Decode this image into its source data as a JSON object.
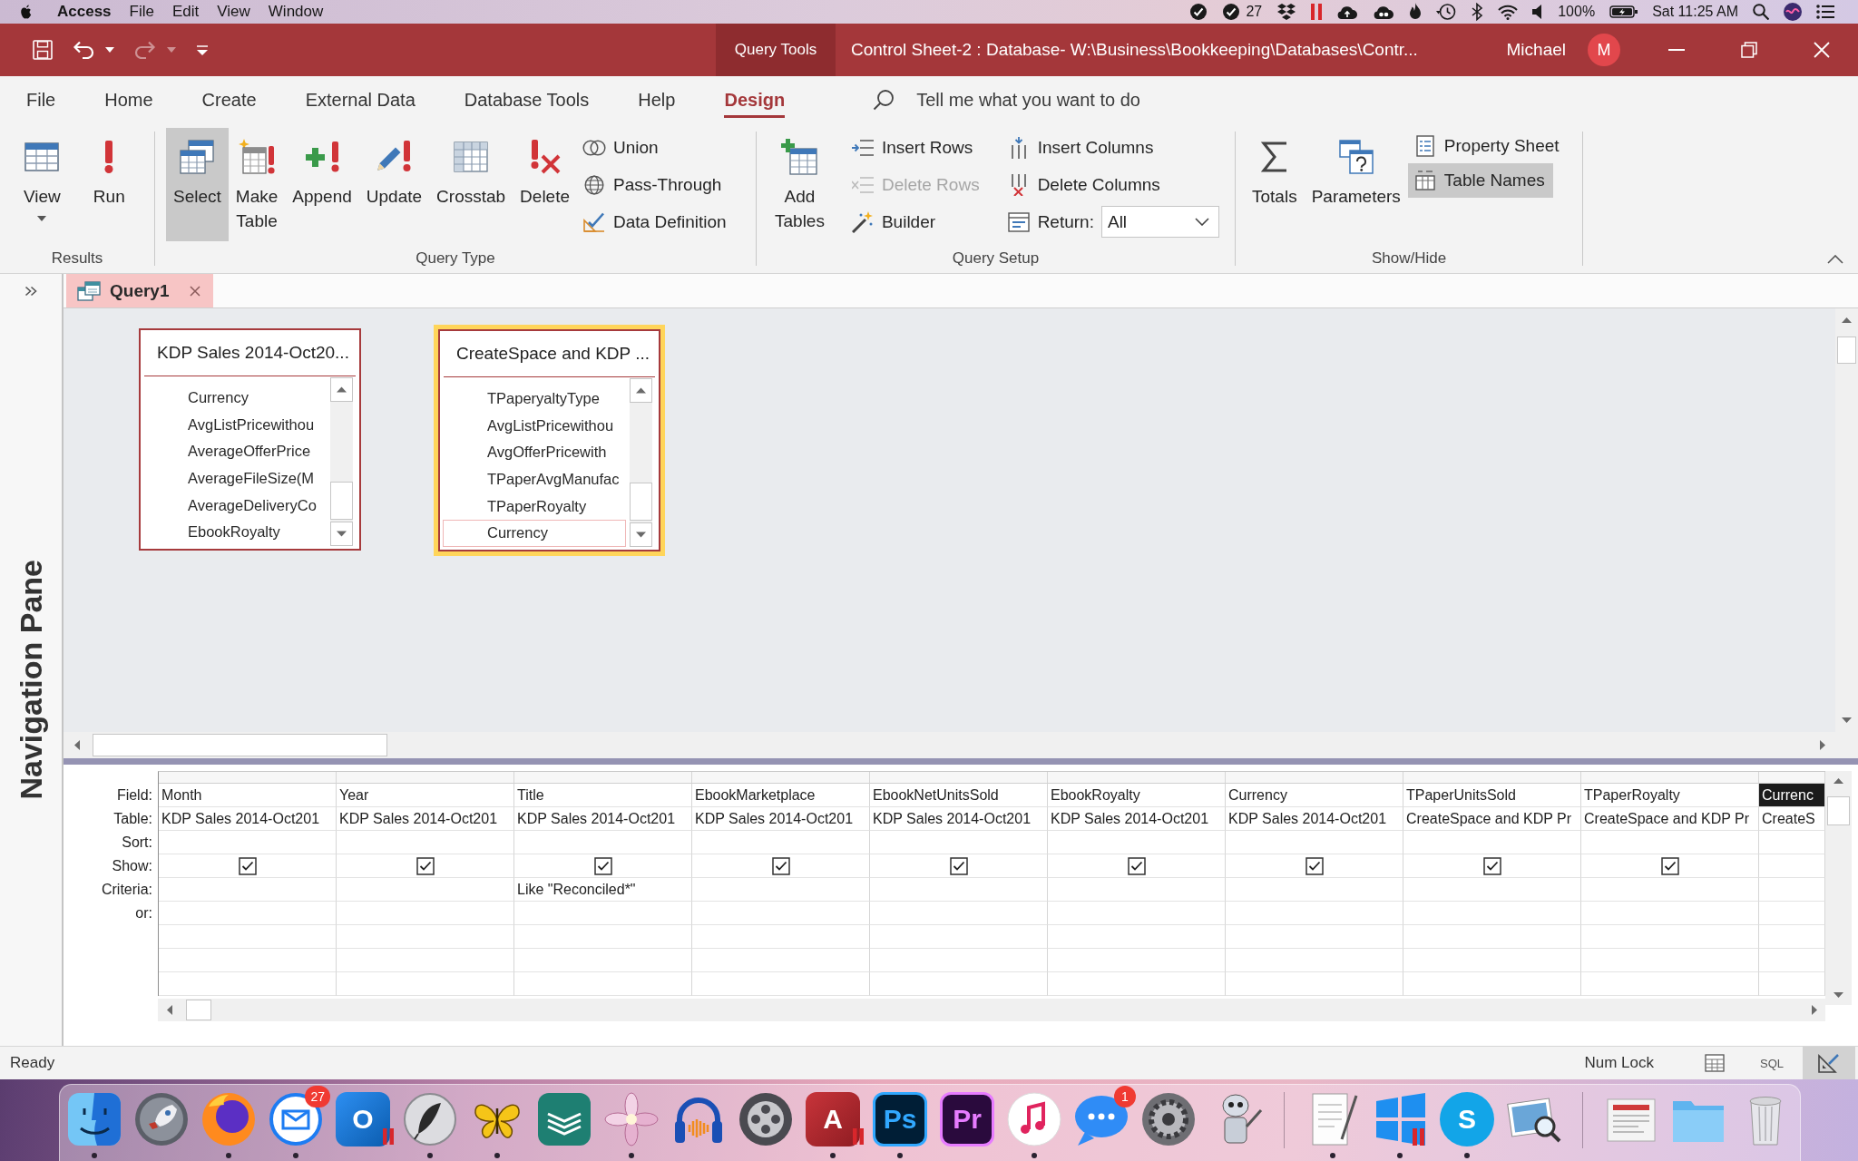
{
  "menu_bar": {
    "app": "Access",
    "menus": [
      "File",
      "Edit",
      "View",
      "Window"
    ],
    "mail_count": "27",
    "battery": "100%",
    "clock": "Sat 11:25 AM"
  },
  "title_bar": {
    "quick_access": [
      {
        "disabled": false
      },
      {
        "disabled": false
      },
      {
        "disabled": true
      },
      {
        "disabled": false
      }
    ],
    "context_tab": "Query Tools",
    "title": "Control Sheet-2 : Database- W:\\Business\\Bookkeeping\\Databases\\Contr...",
    "user": "Michael",
    "avatar": "M"
  },
  "ribbon": {
    "tabs": [
      {
        "label": "File",
        "selected": false
      },
      {
        "label": "Home",
        "selected": false
      },
      {
        "label": "Create",
        "selected": false
      },
      {
        "label": "External Data",
        "selected": false
      },
      {
        "label": "Database Tools",
        "selected": false
      },
      {
        "label": "Help",
        "selected": false
      },
      {
        "label": "Design",
        "selected": true
      }
    ],
    "search": {
      "placeholder": "Tell me what you want to do"
    },
    "groups": [
      {
        "label": "Results",
        "items": [
          {
            "kind": "large",
            "label": "View",
            "dropdown": true
          },
          {
            "kind": "large",
            "label": "Run"
          }
        ]
      },
      {
        "label": "Query Type",
        "items": [
          {
            "kind": "large",
            "label": "Select",
            "selected": true
          },
          {
            "kind": "large",
            "label": "Make Table",
            "selected": false
          },
          {
            "kind": "large",
            "label": "Append",
            "selected": false
          },
          {
            "kind": "large",
            "label": "Update",
            "selected": false
          },
          {
            "kind": "large",
            "label": "Crosstab",
            "selected": false
          },
          {
            "kind": "large",
            "label": "Delete",
            "selected": false
          },
          {
            "kind": "stack",
            "items": [
              {
                "kind": "small",
                "label": "Union",
                "selected": false
              },
              {
                "kind": "small",
                "label": "Pass-Through",
                "selected": false
              },
              {
                "kind": "small",
                "label": "Data Definition",
                "selected": false
              }
            ]
          }
        ]
      },
      {
        "label": "Query Setup",
        "items": [
          {
            "kind": "large",
            "label": "Add Tables"
          },
          {
            "kind": "stack",
            "items": [
              {
                "kind": "small",
                "label": "Insert Rows",
                "disabled": false
              },
              {
                "kind": "small",
                "label": "Delete Rows",
                "disabled": true
              },
              {
                "kind": "small",
                "label": "Builder",
                "disabled": false
              }
            ]
          },
          {
            "kind": "stack",
            "items": [
              {
                "kind": "small",
                "label": "Insert Columns",
                "disabled": false
              },
              {
                "kind": "small",
                "label": "Delete Columns",
                "disabled": false
              },
              {
                "kind": "select",
                "label": "Return:",
                "value": "All"
              }
            ]
          }
        ]
      },
      {
        "label": "Show/Hide",
        "items": [
          {
            "kind": "large",
            "label": "Totals",
            "selected": false
          },
          {
            "kind": "large",
            "label": "Parameters"
          },
          {
            "kind": "stack",
            "items": [
              {
                "kind": "small",
                "label": "Property Sheet",
                "selected": false
              },
              {
                "kind": "small",
                "label": "Table Names",
                "selected": true
              }
            ]
          }
        ]
      }
    ]
  },
  "navigation_pane": {
    "label": "Navigation Pane"
  },
  "document_tabs": [
    {
      "label": "Query1",
      "selected": true
    }
  ],
  "query_design": {
    "tables": [
      {
        "title": "KDP Sales 2014-Oct20...",
        "selected": false,
        "fields": [
          {
            "name": "Currency",
            "selected": false
          },
          {
            "name": "AvgListPricewithou",
            "selected": false
          },
          {
            "name": "AverageOfferPrice",
            "selected": false
          },
          {
            "name": "AverageFileSize(M",
            "selected": false
          },
          {
            "name": "AverageDeliveryCo",
            "selected": false
          },
          {
            "name": "EbookRoyalty",
            "selected": false
          }
        ]
      },
      {
        "title": "CreateSpace and KDP ...",
        "selected": true,
        "fields": [
          {
            "name": "TPaperyaltyType",
            "selected": false
          },
          {
            "name": "AvgListPricewithou",
            "selected": false
          },
          {
            "name": "AvgOfferPricewith",
            "selected": false
          },
          {
            "name": "TPaperAvgManufac",
            "selected": false
          },
          {
            "name": "TPaperRoyalty",
            "selected": false
          },
          {
            "name": "Currency",
            "selected": true
          }
        ]
      }
    ]
  },
  "design_grid": {
    "row_labels": [
      "Field:",
      "Table:",
      "Sort:",
      "Show:",
      "Criteria:",
      "or:"
    ],
    "columns": [
      {
        "field": "Month",
        "table": "KDP Sales 2014-Oct201",
        "show": true,
        "selected": false
      },
      {
        "field": "Year",
        "table": "KDP Sales 2014-Oct201",
        "show": true,
        "selected": false
      },
      {
        "field": "Title",
        "table": "KDP Sales 2014-Oct201",
        "show": true,
        "criteria": "Like \"Reconciled*\"",
        "selected": false
      },
      {
        "field": "EbookMarketplace",
        "table": "KDP Sales 2014-Oct201",
        "show": true,
        "selected": false
      },
      {
        "field": "EbookNetUnitsSold",
        "table": "KDP Sales 2014-Oct201",
        "show": true,
        "selected": false
      },
      {
        "field": "EbookRoyalty",
        "table": "KDP Sales 2014-Oct201",
        "show": true,
        "selected": false
      },
      {
        "field": "Currency",
        "table": "KDP Sales 2014-Oct201",
        "show": true,
        "selected": false
      },
      {
        "field": "TPaperUnitsSold",
        "table": "CreateSpace and KDP Pr",
        "show": true,
        "selected": false
      },
      {
        "field": "TPaperRoyalty",
        "table": "CreateSpace and KDP Pr",
        "show": true,
        "selected": false
      },
      {
        "field": "Currenc",
        "table": "CreateS",
        "selected": true
      }
    ]
  },
  "status_bar": {
    "status": "Ready",
    "indicator": "Num Lock",
    "views": [
      {
        "selected": false
      },
      {
        "label": "SQL",
        "selected": false
      },
      {
        "selected": true
      }
    ]
  },
  "dock": {
    "sections": [
      {
        "items": [
          {
            "running": true
          },
          {
            "running": false
          },
          {
            "running": true
          },
          {
            "running": true,
            "badge": "27"
          },
          {
            "label": "O",
            "running": false
          },
          {
            "running": true
          },
          {
            "running": true
          },
          {
            "running": false
          },
          {
            "running": true
          },
          {
            "running": false
          },
          {
            "running": false
          },
          {
            "label": "A",
            "running": true
          },
          {
            "label": "Ps",
            "running": true
          },
          {
            "label": "Pr",
            "running": false
          },
          {
            "running": true
          },
          {
            "running": false,
            "badge": "1"
          },
          {
            "running": false
          },
          {
            "running": false
          }
        ]
      },
      {
        "items": [
          {
            "running": true
          },
          {
            "running": true
          },
          {
            "label": "S",
            "running": true
          },
          {
            "running": false
          }
        ]
      },
      {
        "items": [
          {
            "running": false
          },
          {
            "running": false
          },
          {
            "running": false
          }
        ]
      }
    ]
  }
}
